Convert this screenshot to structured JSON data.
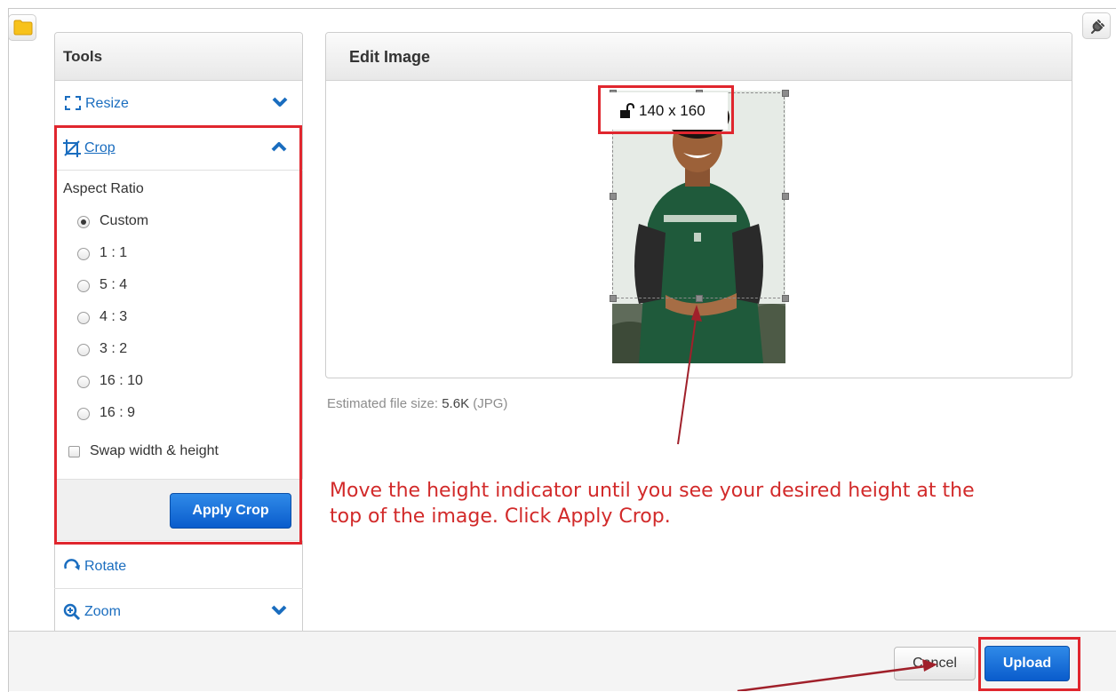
{
  "toolbar": {
    "folder_icon": "folder-icon",
    "plugin_icon": "plug-icon"
  },
  "tools": {
    "title": "Tools",
    "resize": {
      "label": "Resize",
      "icon": "resize-icon"
    },
    "crop": {
      "label": "Crop",
      "icon": "crop-icon",
      "aspect_title": "Aspect Ratio",
      "options": [
        "Custom",
        "1 : 1",
        "5 : 4",
        "4 : 3",
        "3 : 2",
        "16 : 10",
        "16 : 9"
      ],
      "selected": "Custom",
      "swap_label": "Swap width & height",
      "apply_label": "Apply Crop"
    },
    "rotate": {
      "label": "Rotate",
      "icon": "rotate-icon"
    },
    "zoom": {
      "label": "Zoom",
      "icon": "zoom-icon"
    }
  },
  "editor": {
    "title": "Edit Image",
    "crop_size": "140 x 160",
    "filesize_label": "Estimated file size:",
    "filesize_value": "5.6K",
    "filesize_format": "(JPG)"
  },
  "annotation": {
    "note_line1": "Move the height indicator until you see your desired height at the",
    "note_line2": "top of the image. Click Apply Crop.",
    "color": "#d22a2a"
  },
  "footer": {
    "cancel_label": "Cancel",
    "upload_label": "Upload"
  },
  "colors": {
    "accent": "#1a6dbf",
    "primary_button": "#0a5ccc",
    "highlight": "#e0262e"
  }
}
